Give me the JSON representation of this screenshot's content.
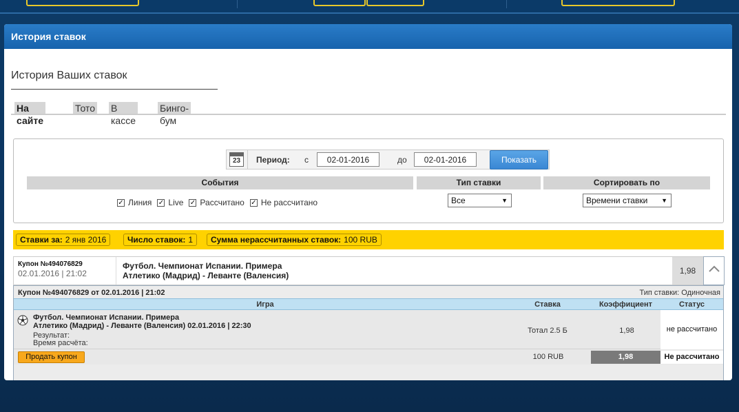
{
  "panel": {
    "title": "История ставок"
  },
  "subtitle": "История Ваших ставок",
  "tabs": [
    {
      "label": "На сайте",
      "active": true
    },
    {
      "label": "Тото"
    },
    {
      "label": "В кассе"
    },
    {
      "label": "Бинго-бум"
    }
  ],
  "filter": {
    "calendar_day": "23",
    "period_label": "Период:",
    "from_label": "с",
    "from_value": "02-01-2016",
    "to_label": "до",
    "to_value": "02-01-2016",
    "show_button": "Показать",
    "col_events": "События",
    "col_bet_type": "Тип ставки",
    "col_sort": "Сортировать по",
    "checkboxes": [
      {
        "label": "Линия",
        "checked": true
      },
      {
        "label": "Live",
        "checked": true
      },
      {
        "label": "Рассчитано",
        "checked": true
      },
      {
        "label": "Не рассчитано",
        "checked": true
      }
    ],
    "bet_type_value": "Все",
    "sort_value": "Времени ставки"
  },
  "summary": {
    "bets_for_label": "Ставки за:",
    "bets_for_value": "2 янв 2016",
    "count_label": "Число ставок:",
    "count_value": "1",
    "unsettled_label": "Сумма нерассчитанных ставок:",
    "unsettled_value": "100 RUB"
  },
  "coupon": {
    "id": "Купон №494076829",
    "datetime": "02.01.2016 | 21:02",
    "event_line1": "Футбол. Чемпионат Испании. Примера",
    "event_line2": "Атлетико (Мадрид) - Леванте (Валенсия)",
    "odds": "1,98"
  },
  "detail": {
    "header_left": "Купон №494076829 от 02.01.2016 | 21:02",
    "header_right": "Тип ставки: Одиночная",
    "columns": {
      "game": "Игра",
      "stake": "Ставка",
      "koef": "Коэффициент",
      "status": "Статус"
    },
    "row": {
      "league": "Футбол. Чемпионат Испании. Примера",
      "match": "Атлетико (Мадрид) - Леванте (Валенсия) 02.01.2016 | 22:30",
      "result_label": "Результат:",
      "settle_time_label": "Время расчёта:",
      "stake": "Тотал 2.5 Б",
      "koef": "1,98",
      "status": "не рассчитано"
    },
    "footer": {
      "sell_button": "Продать купон",
      "total_stake": "100 RUB",
      "total_koef": "1,98",
      "total_status": "Не рассчитано"
    }
  },
  "colors": {
    "accent": "#1d6fbf",
    "summary_bar": "#ffd200",
    "sell_button": "#f8a81c"
  }
}
